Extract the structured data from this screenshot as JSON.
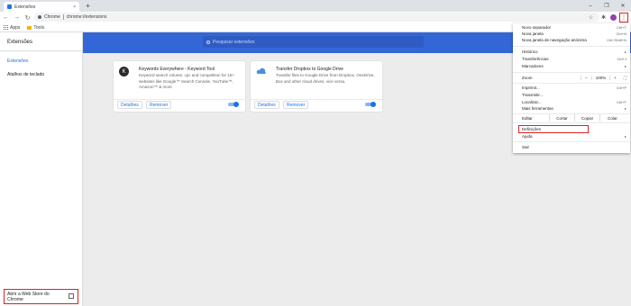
{
  "browser": {
    "tab_title": "Extensões",
    "tab_close": "×",
    "new_tab": "+",
    "win_min": "–",
    "win_max": "❐",
    "win_close": "✕",
    "back": "←",
    "forward": "→",
    "reload": "↻",
    "site_label": "Chrome",
    "url": "chrome://extensions",
    "star": "☆",
    "puzzle": "✱",
    "menu_dots": "⋮"
  },
  "bookmarks": [
    {
      "label": "Apps",
      "icon": "apps-grid-icon"
    },
    {
      "label": "Tools",
      "icon": "folder-icon"
    }
  ],
  "sidebar": {
    "title": "Extensões",
    "items": [
      {
        "label": "Extensões"
      },
      {
        "label": "Atalhos de teclado"
      }
    ],
    "webstore_label": "Abrir a Web Store do Chrome"
  },
  "main": {
    "search_placeholder": "Pesquisar extensões",
    "cards": [
      {
        "name": "Keywords Everywhere - Keyword Tool",
        "description": "Keyword search volume, cpc and competition for 15+ websites like Google™ Search Console, YouTube™, Amazon™ & more",
        "details_label": "Detalhes",
        "remove_label": "Remover",
        "icon_color": "#2b2b2b",
        "icon_letter": "K",
        "enabled": true
      },
      {
        "name": "Transfer Dropbox to Google Drive",
        "description": "Transfer files to Google Drive from Dropbox, OneDrive, Box and other cloud drives, vice versa.",
        "details_label": "Detalhes",
        "remove_label": "Remover",
        "icon_color": "#4a90d9",
        "icon_letter": "",
        "enabled": true
      }
    ]
  },
  "menu": {
    "items_top": [
      {
        "label": "Novo separador",
        "shortcut": "Ctrl+T"
      },
      {
        "label": "Nova janela",
        "shortcut": "Ctrl+N"
      },
      {
        "label": "Nova janela de navegação anónima",
        "shortcut": "Ctrl+Shift+N"
      }
    ],
    "items_mid": [
      {
        "label": "Histórico",
        "shortcut": "▸"
      },
      {
        "label": "Transferências",
        "shortcut": "Ctrl+J"
      },
      {
        "label": "Marcadores",
        "shortcut": "▸"
      }
    ],
    "zoom_label": "Zoom",
    "zoom_minus": "–",
    "zoom_value": "100%",
    "zoom_plus": "+",
    "fullscreen": "⛶",
    "items_tools": [
      {
        "label": "Imprimir...",
        "shortcut": "Ctrl+P"
      },
      {
        "label": "Transmitir...",
        "shortcut": ""
      },
      {
        "label": "Localizar...",
        "shortcut": "Ctrl+F"
      },
      {
        "label": "Mais ferramentas",
        "shortcut": "▸"
      }
    ],
    "edit_label": "Editar",
    "cut_label": "Cortar",
    "copy_label": "Copiar",
    "paste_label": "Colar",
    "settings_label": "Definições",
    "help_label": "Ajuda",
    "help_arrow": "▸",
    "exit_label": "Sair"
  },
  "colors": {
    "accent": "#1a73e8",
    "header_band": "#3367d6",
    "highlight": "#e02020"
  }
}
